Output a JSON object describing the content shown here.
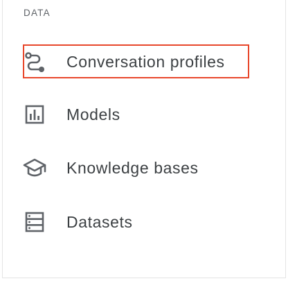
{
  "sidebar": {
    "section_heading": "DATA",
    "items": [
      {
        "label": "Conversation profiles",
        "icon": "route-icon"
      },
      {
        "label": "Models",
        "icon": "bar-chart-icon"
      },
      {
        "label": "Knowledge bases",
        "icon": "school-icon"
      },
      {
        "label": "Datasets",
        "icon": "storage-icon"
      }
    ]
  },
  "colors": {
    "highlight": "#e8472b",
    "text": "#3c4043",
    "icon": "#5f6368",
    "heading": "#5f6368"
  }
}
